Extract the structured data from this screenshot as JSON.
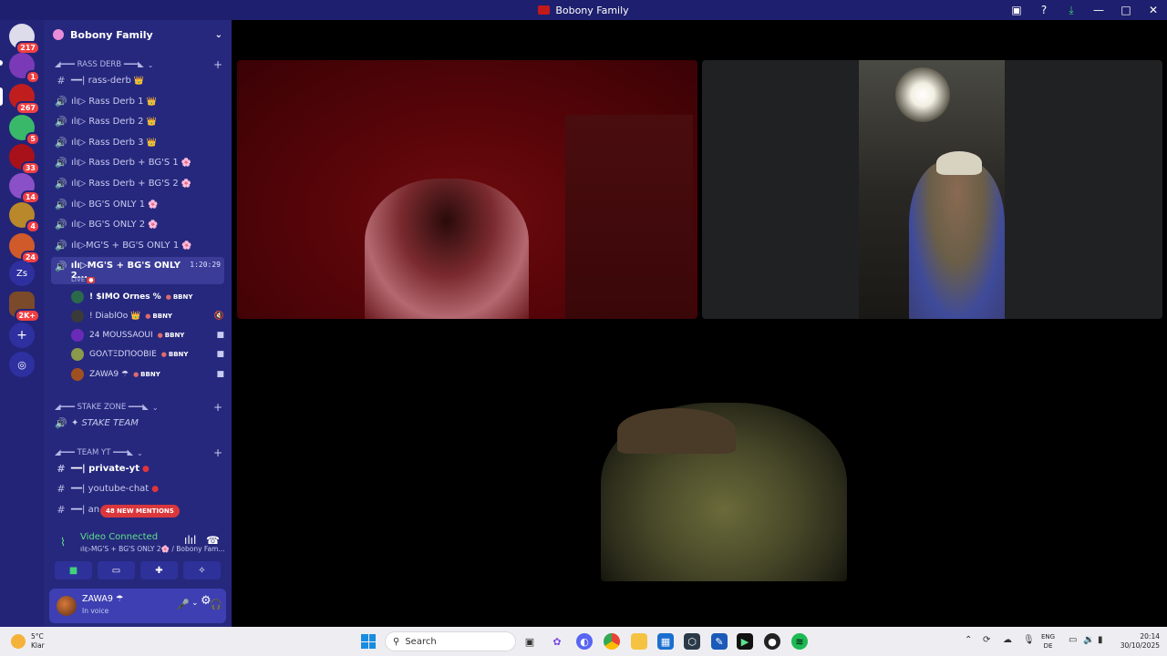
{
  "window": {
    "title": "Bobony Family"
  },
  "rail": {
    "servers": [
      {
        "name": "server-home",
        "badge": "217",
        "color": "#d0d0e0"
      },
      {
        "name": "server-1",
        "badge": "1",
        "color": "#7a3ab8"
      },
      {
        "name": "server-2",
        "badge": "267",
        "color": "#c01e1e"
      },
      {
        "name": "server-3",
        "badge": "5",
        "color": "#3ab86a"
      },
      {
        "name": "server-4",
        "badge": "33",
        "color": "#a8101a"
      },
      {
        "name": "server-5",
        "badge": "14",
        "color": "#8a50c8"
      },
      {
        "name": "server-6",
        "badge": "4",
        "color": "#b8882a"
      },
      {
        "name": "server-7",
        "badge": "24",
        "color": "#d05a2a"
      },
      {
        "name": "server-zs",
        "label": "Zs"
      },
      {
        "name": "server-8",
        "badge": "2K+",
        "color": "#7a4a2a"
      }
    ]
  },
  "sidebar": {
    "guild_name": "Bobony Family",
    "categories": {
      "rass_derb": "◢━━━ RASS DERB ━━━◣",
      "stake_zone": "◢━━━ STAKE ZONE ━━━◣",
      "team_yt": "◢━━━ TEAM YT ━━━◣"
    },
    "channels": [
      {
        "label": "━━| rass-derb",
        "emoji": "👑",
        "type": "text"
      },
      {
        "label": "ılı▷ Rass Derb 1",
        "emoji": "👑",
        "type": "voice"
      },
      {
        "label": "ılı▷ Rass Derb 2",
        "emoji": "👑",
        "type": "voice"
      },
      {
        "label": "ılı▷ Rass Derb 3",
        "emoji": "👑",
        "type": "voice"
      },
      {
        "label": "ılı▷ Rass Derb + BG'S 1",
        "emoji": "🌸",
        "type": "voice"
      },
      {
        "label": "ılı▷ Rass Derb + BG'S 2",
        "emoji": "🌸",
        "type": "voice"
      },
      {
        "label": "ılı▷ BG'S ONLY 1",
        "emoji": "🌸",
        "type": "voice"
      },
      {
        "label": "ılı▷ BG'S ONLY 2",
        "emoji": "🌸",
        "type": "voice"
      },
      {
        "label": "ılı▷MG'S + BG'S ONLY 1",
        "emoji": "🌸",
        "type": "voice"
      },
      {
        "label": "ılı▷MG'S + BG'S ONLY 2...",
        "emoji": "",
        "type": "voice",
        "time": "1:20:29"
      }
    ],
    "live_label": "LIVE",
    "voice_users": [
      {
        "name": "! $IMO Ornes %",
        "tag": "BBNY",
        "color": "#2a6a4a",
        "icon": ""
      },
      {
        "name": "! DiablOo 👑",
        "tag": "BBNY",
        "color": "#3a3a3a",
        "icon": "🔇"
      },
      {
        "name": "24 MOUSSAOUI",
        "tag": "BBNY",
        "color": "#6a2ab8",
        "icon": "📹"
      },
      {
        "name": "GOΛTΞDΠOOBIE",
        "tag": "BBNY",
        "color": "#8a9a4a",
        "icon": "📹"
      },
      {
        "name": "ZAWA9 ☂",
        "tag": "BBNY",
        "color": "#a05020",
        "icon": "📹"
      }
    ],
    "stake_channel": "✦ STAKE TEAM",
    "yt_channels": [
      {
        "label": "━━| private-yt",
        "type": "text"
      },
      {
        "label": "━━| youtube-chat",
        "type": "text"
      },
      {
        "label": "━━| an",
        "type": "text"
      }
    ],
    "mentions_label": "48 NEW MENTIONS"
  },
  "voice_panel": {
    "title": "Video Connected",
    "subtitle": "ılı▷MG'S + BG'S ONLY 2🌸 / Bobony Fam..."
  },
  "user_panel": {
    "name": "ZAWA9 ☂",
    "status": "In voice"
  },
  "taskbar": {
    "weather_temp": "5°C",
    "weather_desc": "Klar",
    "search_placeholder": "Search",
    "lang_1": "ENG",
    "lang_2": "DE",
    "time": "20:14",
    "date": "30/10/2025"
  }
}
